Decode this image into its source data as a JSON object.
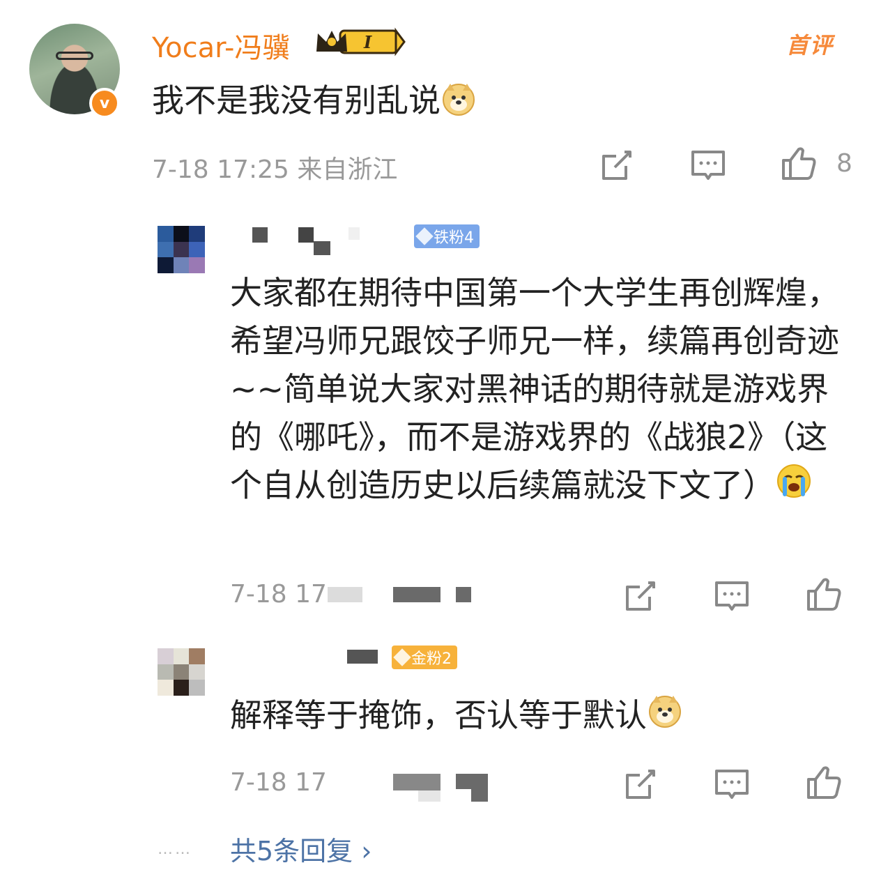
{
  "main_comment": {
    "username": "Yocar-冯骥",
    "verified_badge": "v",
    "vip_level": "I",
    "first_tag": "首评",
    "text": "我不是我没有别乱说",
    "emoji": "doge",
    "timestamp": "7-18 17:25",
    "location": "来自浙江",
    "like_count": "8",
    "accent_color": "#f07d1b"
  },
  "replies": [
    {
      "fan_badge": "铁粉4",
      "fan_badge_color": "#7aa6ea",
      "text": "大家都在期待中国第一个大学生再创辉煌，希望冯师兄跟饺子师兄一样，续篇再创奇迹~~简单说大家对黑神话的期待就是游戏界的《哪吒》，而不是游戏界的《战狼2》（这个自从创造历史以后续篇就没下文了）",
      "emoji": "crying-face",
      "timestamp": "7-18 17"
    },
    {
      "fan_badge": "金粉2",
      "fan_badge_color": "#f7b23b",
      "text": "解释等于掩饰，否认等于默认",
      "emoji": "doge",
      "timestamp": "7-18 17"
    }
  ],
  "more_replies": {
    "dots": "……",
    "label": "共5条回复",
    "chevron": "›"
  },
  "icons": {
    "share": "share-icon",
    "comment": "comment-icon",
    "like": "thumbs-up-icon"
  }
}
